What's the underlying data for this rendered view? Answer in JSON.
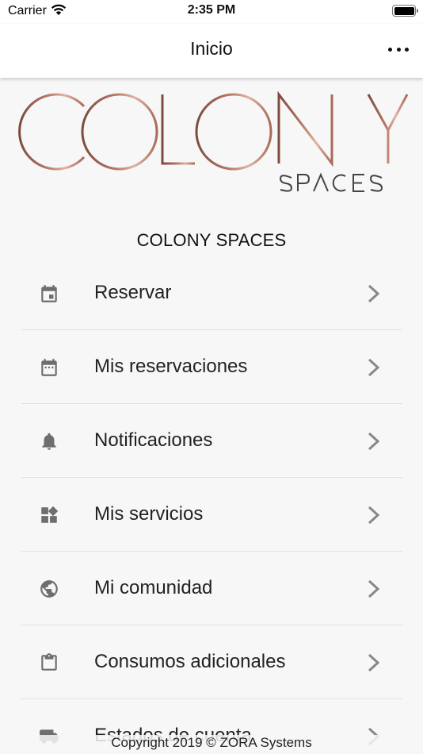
{
  "status_bar": {
    "carrier": "Carrier",
    "time": "2:35 PM"
  },
  "nav": {
    "title": "Inicio",
    "more_icon": "more-horizontal-icon"
  },
  "logo": {
    "main": "COLONY",
    "sub": "SPACES",
    "color_dark": "#8a5a4a",
    "color_light": "#d8a592"
  },
  "section_title": "COLONY SPACES",
  "menu": [
    {
      "label": "Reservar",
      "icon": "calendar-icon"
    },
    {
      "label": "Mis reservaciones",
      "icon": "calendar-dots-icon"
    },
    {
      "label": "Notificaciones",
      "icon": "bell-icon"
    },
    {
      "label": "Mis servicios",
      "icon": "widgets-icon"
    },
    {
      "label": "Mi comunidad",
      "icon": "globe-icon"
    },
    {
      "label": "Consumos adicionales",
      "icon": "clipboard-icon"
    },
    {
      "label": "Estados de cuenta",
      "icon": "truck-icon"
    }
  ],
  "footer": "Copyright 2019 © ZORA Systems",
  "colors": {
    "icon": "#6e6e6e",
    "background": "#f7f7f7",
    "divider": "#e2e2e2"
  }
}
